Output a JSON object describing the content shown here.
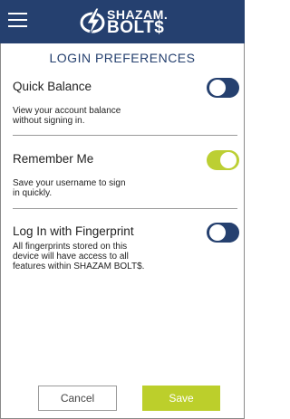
{
  "header": {
    "logo": {
      "line1": "SHAZAM.",
      "line2": "BOLT$"
    }
  },
  "page": {
    "title": "LOGIN PREFERENCES"
  },
  "preferences": [
    {
      "label": "Quick Balance",
      "description": "View your account balance without signing in.",
      "enabled": false
    },
    {
      "label": "Remember Me",
      "description": "Save your username to sign in quickly.",
      "enabled": true
    },
    {
      "label": "Log In with Fingerprint",
      "description": "All fingerprints stored on this device will have access to all features within SHAZAM BOLT$.",
      "enabled": false
    }
  ],
  "footer": {
    "cancel_label": "Cancel",
    "save_label": "Save"
  },
  "colors": {
    "header": "#25406f",
    "toggle_off": "#25406f",
    "toggle_on": "#bccf33",
    "save_button": "#bccf2b"
  }
}
